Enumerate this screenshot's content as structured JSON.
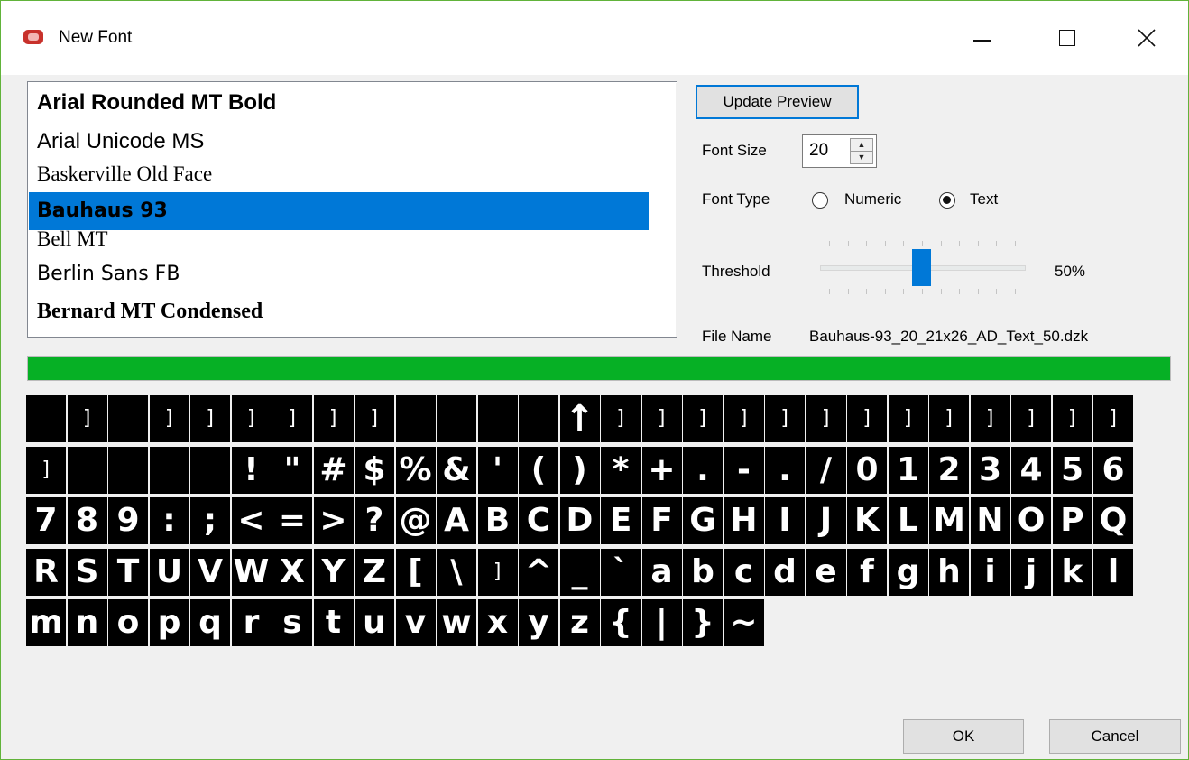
{
  "window": {
    "title": "New Font",
    "icons": {
      "app": "app-icon",
      "minimize": "minimize-icon",
      "maximize": "maximize-icon",
      "close": "close-icon"
    }
  },
  "font_list": {
    "items": [
      {
        "label": "Arial Rounded MT Bold",
        "font": "\"Liberation Sans\", sans-serif",
        "weight": "bold",
        "size": "24px",
        "selected": false
      },
      {
        "label": "Arial Unicode MS",
        "font": "\"Liberation Sans\", sans-serif",
        "weight": "normal",
        "size": "24px",
        "selected": false
      },
      {
        "label": "Baskerville Old Face",
        "font": "\"Liberation Serif\", serif",
        "weight": "normal",
        "size": "23px",
        "selected": false
      },
      {
        "label": "Bauhaus 93",
        "font": "\"DejaVu Sans\", sans-serif",
        "weight": "bold",
        "size": "22px",
        "selected": true
      },
      {
        "label": "Bell MT",
        "font": "\"Liberation Serif\", serif",
        "weight": "normal",
        "size": "23px",
        "selected": false
      },
      {
        "label": "Berlin Sans FB",
        "font": "\"DejaVu Sans\", sans-serif",
        "weight": "normal",
        "size": "22px",
        "selected": false
      },
      {
        "label": "Bernard MT Condensed",
        "font": "\"Liberation Serif\", serif",
        "weight": "bold",
        "size": "24px",
        "selected": false
      }
    ],
    "scroll_up_icon": "chevron-up-icon",
    "scroll_down_icon": "chevron-down-icon"
  },
  "controls": {
    "update_preview": "Update Preview",
    "font_size_label": "Font Size",
    "font_size_value": "20",
    "font_type_label": "Font Type",
    "font_type_options": [
      {
        "label": "Numeric",
        "selected": false
      },
      {
        "label": "Text",
        "selected": true
      }
    ],
    "threshold_label": "Threshold",
    "threshold_value": "50%",
    "threshold_fraction": 0.5,
    "file_name_label": "File Name",
    "file_name_value": "Bauhaus-93_20_21x26_AD_Text_50.dzk"
  },
  "progress": {
    "fraction": 1.0,
    "color": "#06b025"
  },
  "preview": {
    "glyphs": [
      "",
      "]",
      "",
      "]",
      "]",
      "]",
      "]",
      "]",
      "]",
      "",
      "",
      "",
      "",
      "↑",
      "]",
      "]",
      "]",
      "]",
      "]",
      "]",
      "]",
      "]",
      "]",
      "]",
      "]",
      "]",
      "]",
      "]",
      "",
      "",
      "",
      "",
      "!",
      "\"",
      "#",
      "$",
      "%",
      "&",
      "'",
      "(",
      ")",
      "*",
      "+",
      ".",
      "-",
      ".",
      "/",
      "0",
      "1",
      "2",
      "3",
      "4",
      "5",
      "6",
      "7",
      "8",
      "9",
      ":",
      ";",
      "<",
      "=",
      ">",
      "?",
      "@",
      "A",
      "B",
      "C",
      "D",
      "E",
      "F",
      "G",
      "H",
      "I",
      "J",
      "K",
      "L",
      "M",
      "N",
      "O",
      "P",
      "Q",
      "R",
      "S",
      "T",
      "U",
      "V",
      "W",
      "X",
      "Y",
      "Z",
      "[",
      "\\",
      "]",
      "^",
      "_",
      "`",
      "a",
      "b",
      "c",
      "d",
      "e",
      "f",
      "g",
      "h",
      "i",
      "j",
      "k",
      "l",
      "m",
      "n",
      "o",
      "p",
      "q",
      "r",
      "s",
      "t",
      "u",
      "v",
      "w",
      "x",
      "y",
      "z",
      "{",
      "|",
      "}",
      "~"
    ]
  },
  "buttons": {
    "ok": "OK",
    "cancel": "Cancel"
  },
  "colors": {
    "accent": "#0078d7",
    "window_border": "#61b33a"
  }
}
